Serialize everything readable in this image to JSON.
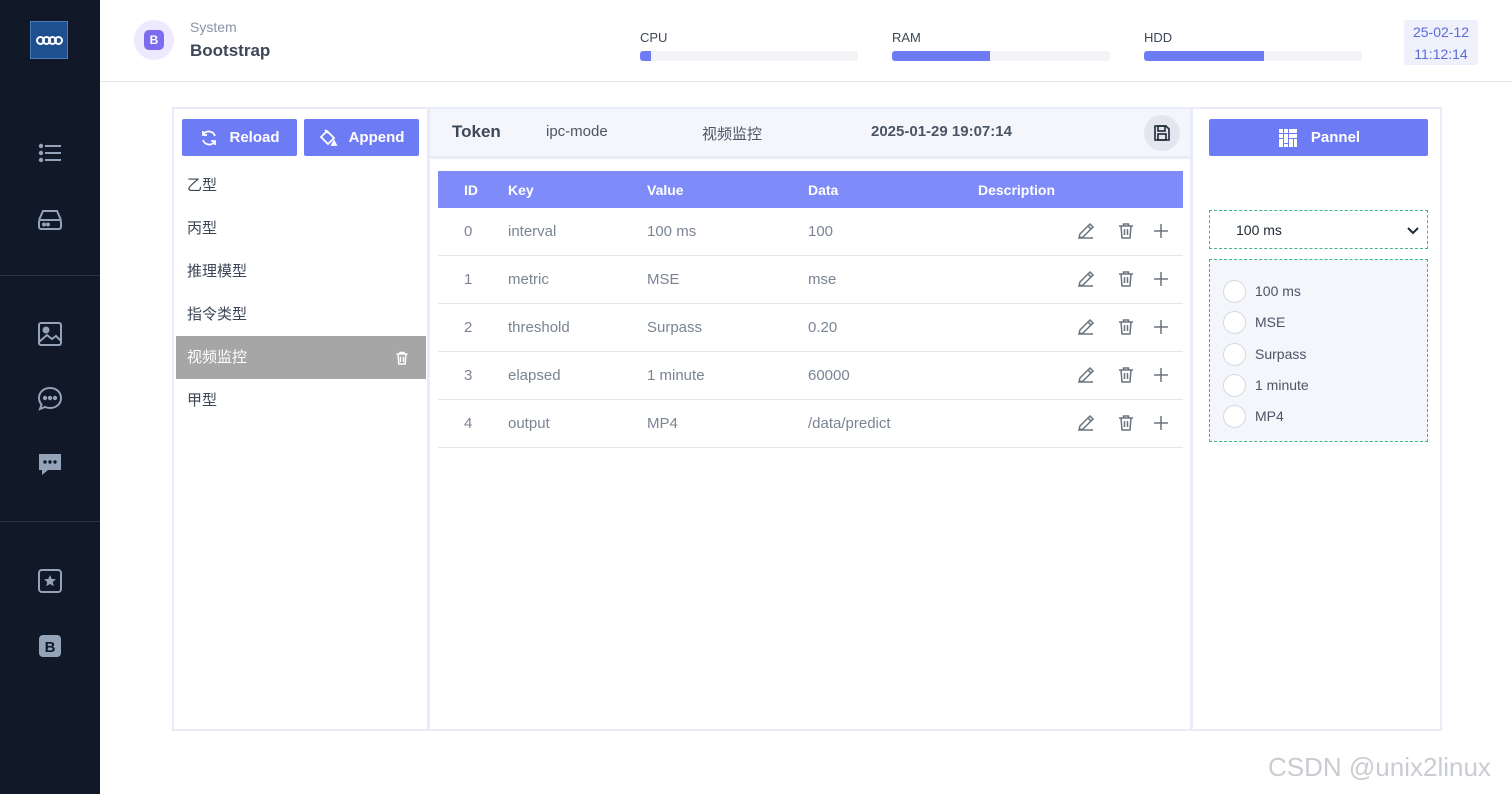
{
  "sidebar": {
    "icons": [
      "list-icon",
      "drive-icon",
      "image-icon",
      "chat-dots-icon",
      "chat-square-dots-icon",
      "star-box-icon",
      "bootstrap-box-icon"
    ]
  },
  "header": {
    "brand_badge": "B",
    "brand_subtitle": "System",
    "brand_title": "Bootstrap",
    "meters": [
      {
        "label": "CPU",
        "fraction": 0.05
      },
      {
        "label": "RAM",
        "fraction": 0.45
      },
      {
        "label": "HDD",
        "fraction": 0.55
      }
    ],
    "date": "25-02-12",
    "time": "11:12:14"
  },
  "left": {
    "reload_label": "Reload",
    "append_label": "Append",
    "items": [
      "乙型",
      "丙型",
      "推理模型",
      "指令类型",
      "视频监控",
      "甲型"
    ],
    "active_index": 4
  },
  "center": {
    "token": "Token",
    "mode": "ipc-mode",
    "name": "视频监控",
    "timestamp": "2025-01-29 19:07:14",
    "columns": [
      "ID",
      "Key",
      "Value",
      "Data",
      "Description"
    ],
    "rows": [
      {
        "id": "0",
        "key": "interval",
        "value": "100 ms",
        "data": "100"
      },
      {
        "id": "1",
        "key": "metric",
        "value": "MSE",
        "data": "mse"
      },
      {
        "id": "2",
        "key": "threshold",
        "value": "Surpass",
        "data": "0.20"
      },
      {
        "id": "3",
        "key": "elapsed",
        "value": "1 minute",
        "data": "60000"
      },
      {
        "id": "4",
        "key": "output",
        "value": "MP4",
        "data": "/data/predict"
      }
    ]
  },
  "right": {
    "pannel_label": "Pannel",
    "select_value": "100 ms",
    "options": [
      "100 ms",
      "MSE",
      "Surpass",
      "1 minute",
      "MP4"
    ]
  },
  "watermark": "CSDN @unix2linux",
  "colors": {
    "accent": "#6d7cf5",
    "sidebar": "#111827",
    "active_item": "#a6a6a6",
    "dashed_border": "#3fb68a"
  }
}
